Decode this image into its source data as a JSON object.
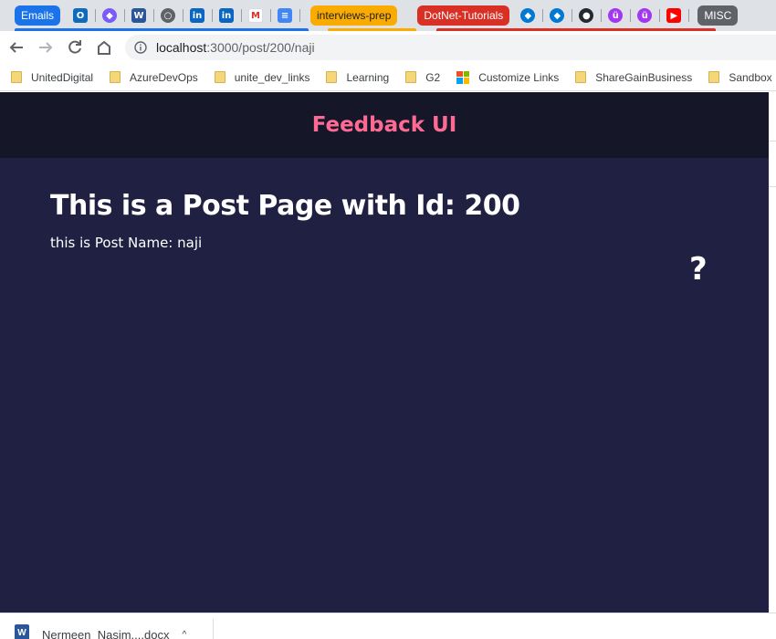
{
  "tabstrip": {
    "groups": [
      {
        "label": "Emails",
        "color": "#1a73e8"
      },
      {
        "label": "interviews-prep",
        "color": "#f9ab00",
        "text_color": "#202124"
      },
      {
        "label": "DotNet-Tutorials",
        "color": "#d93025"
      },
      {
        "label": "MISC",
        "color": "#5f6368"
      }
    ]
  },
  "toolbar": {
    "url_host": "localhost",
    "url_path": ":3000/post/200/naji"
  },
  "bookmarks": [
    {
      "label": "UnitedDigital",
      "icon": "folder-icon"
    },
    {
      "label": "AzureDevOps",
      "icon": "folder-icon"
    },
    {
      "label": "unite_dev_links",
      "icon": "folder-icon"
    },
    {
      "label": "Learning",
      "icon": "folder-icon"
    },
    {
      "label": "G2",
      "icon": "folder-icon"
    },
    {
      "label": "Customize Links",
      "icon": "microsoft-logo-icon"
    },
    {
      "label": "ShareGainBusiness",
      "icon": "folder-icon"
    },
    {
      "label": "Sandbox",
      "icon": "folder-icon"
    }
  ],
  "page": {
    "header_title": "Feedback UI",
    "post_title": "This is a Post Page with Id: 200",
    "post_name": "this is Post Name: naji",
    "about_link": "?",
    "colors": {
      "header_bg": "#161629",
      "page_bg": "#202142",
      "accent": "#ff6a95"
    }
  },
  "downloads": {
    "file_name": "Nermeen_Nasim....docx",
    "caret": "^"
  }
}
